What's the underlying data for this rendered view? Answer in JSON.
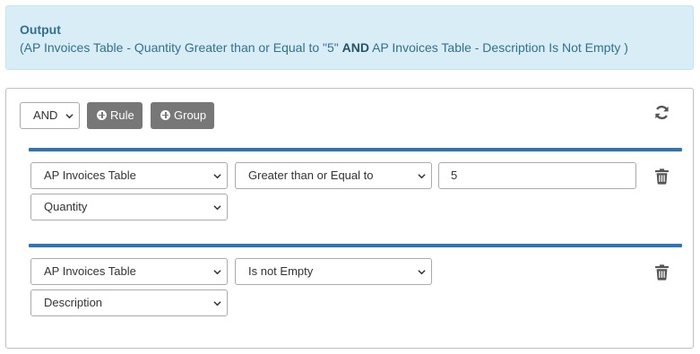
{
  "output": {
    "title": "Output",
    "expr_open": "(",
    "expr_left": "AP Invoices Table - Quantity Greater than or Equal to \"5\"",
    "expr_op": "AND",
    "expr_right": "AP Invoices Table - Description Is Not Empty )"
  },
  "builder": {
    "condition_value": "AND",
    "add_rule_label": "Rule",
    "add_group_label": "Group",
    "rules": [
      {
        "table": "AP Invoices Table",
        "operator": "Greater than or Equal to",
        "value": "5",
        "field": "Quantity"
      },
      {
        "table": "AP Invoices Table",
        "operator": "Is not Empty",
        "field": "Description"
      }
    ]
  },
  "icons": {
    "refresh": "refresh-icon",
    "delete": "trash-icon"
  },
  "colors": {
    "accent": "#2e75b5",
    "output_bg": "#d9edf7",
    "output_text": "#31708f",
    "button_bg": "#777777"
  }
}
